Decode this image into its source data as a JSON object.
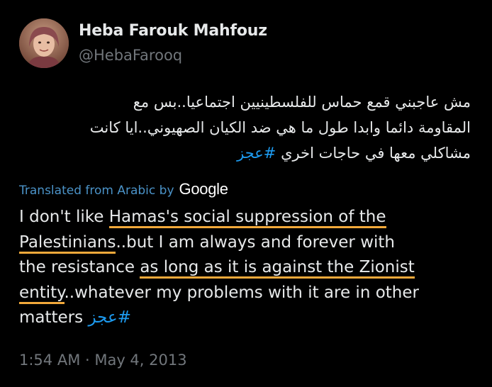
{
  "user": {
    "display_name": "Heba Farouk Mahfouz",
    "handle": "@HebaFarooq"
  },
  "tweet": {
    "arabic_lines": [
      "مش عاجبني قمع حماس للفلسطينيين اجتماعيا..بس مع",
      "المقاومة دائما وابدا طول ما هي ضد الكيان الصهيوني..ايا كانت",
      "مشاكلي معها في حاجات اخري"
    ],
    "arabic_hashtag": "#عجز",
    "translation_label": "Translated from Arabic by",
    "translation_provider": "Google",
    "english": {
      "l1_a": "I don't like ",
      "l1_hl": "Hamas's social suppression of the",
      "l2_hl": "Palestinians",
      "l2_b": "..but I am always and forever with",
      "l3_a": "the resistance ",
      "l3_hl": "as long as it is against the Zionist",
      "l4_hl": "entity",
      "l4_b": "..whatever my problems with it are in other",
      "l5_a": "matters ",
      "l5_hashtag": "عجز#"
    },
    "timestamp": "1:54 AM · May 4, 2013"
  },
  "colors": {
    "background": "#000000",
    "text": "#e7e9ea",
    "muted": "#71767b",
    "link": "#1d9bf0",
    "highlight_underline": "#f2a93b"
  }
}
